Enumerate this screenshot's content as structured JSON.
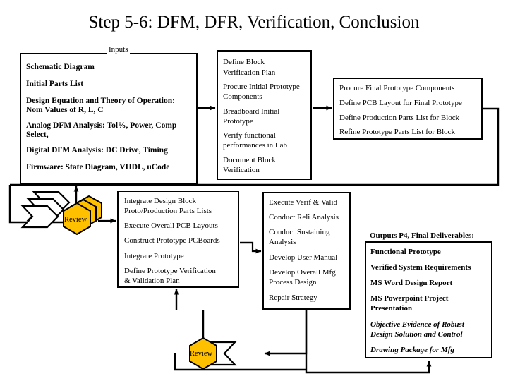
{
  "slide": {
    "title": "Step 5-6: DFM, DFR, Verification, Conclusion",
    "accent_color": "#FFC000",
    "line_color": "#000000",
    "background": "#FFFFFF"
  },
  "inputs_panel": {
    "caption": "Inputs",
    "items": [
      "Schematic Diagram",
      "Initial Parts List",
      "Design Equation and Theory of Operation:",
      "Nom Values of R, L, C",
      "Analog DFM Analysis:  Tol%, Power, Comp",
      "Select,",
      "Digital DFM Analysis:  DC Drive, Timing",
      "Firmware:  State Diagram, VHDL, uCode"
    ]
  },
  "verification_panel": {
    "items": [
      "Define Block",
      "Verification Plan",
      "Procure Initial Prototype",
      "Components",
      "Breadboard Initial",
      "Prototype",
      "Verify functional",
      "performances in Lab",
      "Document Block",
      "Verification"
    ]
  },
  "final_prototype_panel": {
    "items": [
      "Procure Final Prototype Components",
      "Define PCB Layout for Final Prototype",
      "Define Production Parts List for Block",
      "Refine Prototype Parts List for Block"
    ]
  },
  "integrate_panel": {
    "items": [
      "Integrate Design Block",
      "Proto/Production Parts Lists",
      "Execute Overall PCB Layouts",
      "Construct Prototype PCBoards",
      "Integrate Prototype",
      "Define Prototype Verification",
      "& Validation Plan"
    ]
  },
  "verif_valid_panel": {
    "items": [
      "Execute Verif & Valid",
      "Conduct Reli Analysis",
      "Conduct Sustaining",
      "Analysis",
      "Develop User Manual",
      "Develop Overall Mfg",
      "Process Design",
      "Repair Strategy"
    ]
  },
  "outputs_panel": {
    "caption": "Outputs P4, Final Deliverables:",
    "items": [
      {
        "text": "Functional Prototype",
        "italic": false
      },
      {
        "text": "Verified System Requirements",
        "italic": false
      },
      {
        "text": "MS Word Design Report",
        "italic": false
      },
      {
        "text": "MS Powerpoint Project",
        "italic": false
      },
      {
        "text": "Presentation",
        "italic": false
      },
      {
        "text": "Objective Evidence of Robust",
        "italic": true
      },
      {
        "text": "Design Solution and Control",
        "italic": true
      },
      {
        "text": "Drawing Package for Mfg",
        "italic": true
      }
    ]
  },
  "gates": {
    "review_top": "Review",
    "review_bottom": "Review"
  }
}
